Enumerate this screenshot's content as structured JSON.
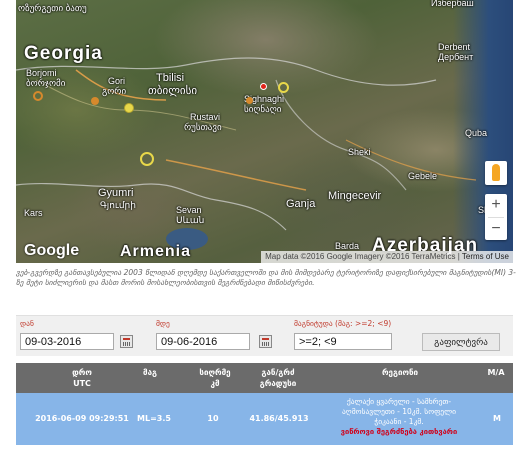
{
  "map": {
    "labels": {
      "georgia": "Georgia",
      "borjomi": "Borjomi",
      "borjomi_ka": "ბორჯომი",
      "gori": "Gori",
      "gori_ka": "გორი",
      "tbilisi": "Tbilisi",
      "tbilisi_ka": "თბილისი",
      "rustavi": "Rustavi",
      "rustavi_ka": "რუსთავი",
      "sighnaghi": "Sighnaghi",
      "sighnaghi_ka": "სიღნაღი",
      "derbent": "Derbent",
      "derbent_ru": "Дербент",
      "izberbash": "Избербаш",
      "quba": "Quba",
      "sheki": "Sheki",
      "gebele": "Gebele",
      "mingecevir": "Mingecevir",
      "ganja": "Ganja",
      "gyumri": "Gyumri",
      "gyumri_hy": "Գյումրի",
      "sevan": "Sevan",
      "sevan_hy": "Սևան",
      "kars": "Kars",
      "barda": "Barda",
      "armenia": "Armenia",
      "azerbaijan": "Azerbaijan",
      "sha": "Sha",
      "top_left": "ოზურგეთი ბათუ"
    },
    "google_logo": "Google",
    "attribution": "Map data ©2016 Google Imagery ©2016 TerraMetrics",
    "terms": "Terms of Use",
    "zoom_in": "+",
    "zoom_out": "−",
    "marker_colors": {
      "yellow": "#e8d84a",
      "orange": "#d6892c",
      "red": "#e0241a"
    }
  },
  "caption": "ვებ-გვერდზე განთავსებულია 2003 წლიდან დღემდე საქართველოში და მის მიმდებარე ტერიტორიზე დაფიქსირებული მაგნიტუდის(MI) 3-ზე მეტი სიძლიერის და მასთ მორის მოსახლეობისთვის შეგრძნებადი მიწისძვრები.",
  "filter": {
    "from_label": "დან",
    "from_value": "09-03-2016",
    "to_label": "მდე",
    "to_value": "09-06-2016",
    "magnitude_label": "მაგნიტუდა (მაგ: >=2; <9)",
    "magnitude_value": ">=2; <9",
    "filter_button": "გაფილტვრა"
  },
  "table": {
    "headers": {
      "time": "დრო",
      "time_sub": "UTC",
      "magnitude": "მაგ",
      "depth": "სიღრმე",
      "depth_sub": "კმ",
      "coords": "გან/გრძ",
      "coords_sub": "გრადუსი",
      "region": "რეგიონი",
      "ma": "M/A"
    },
    "rows": [
      {
        "time": "2016-06-09 09:29:51",
        "magnitude": "ML=3.5",
        "depth": "10",
        "coords": "41.86/45.913",
        "region_line1": "ქალაქი ყვარელი - სამხრეთ-",
        "region_line2": "აღმოსავლეთი - 10კმ. სოფელი",
        "region_line3": "ჭიკაანი - 1კმ.",
        "region_note": "ვიწროვი შეგრძნება კითხვარი",
        "ma": "M"
      }
    ]
  }
}
